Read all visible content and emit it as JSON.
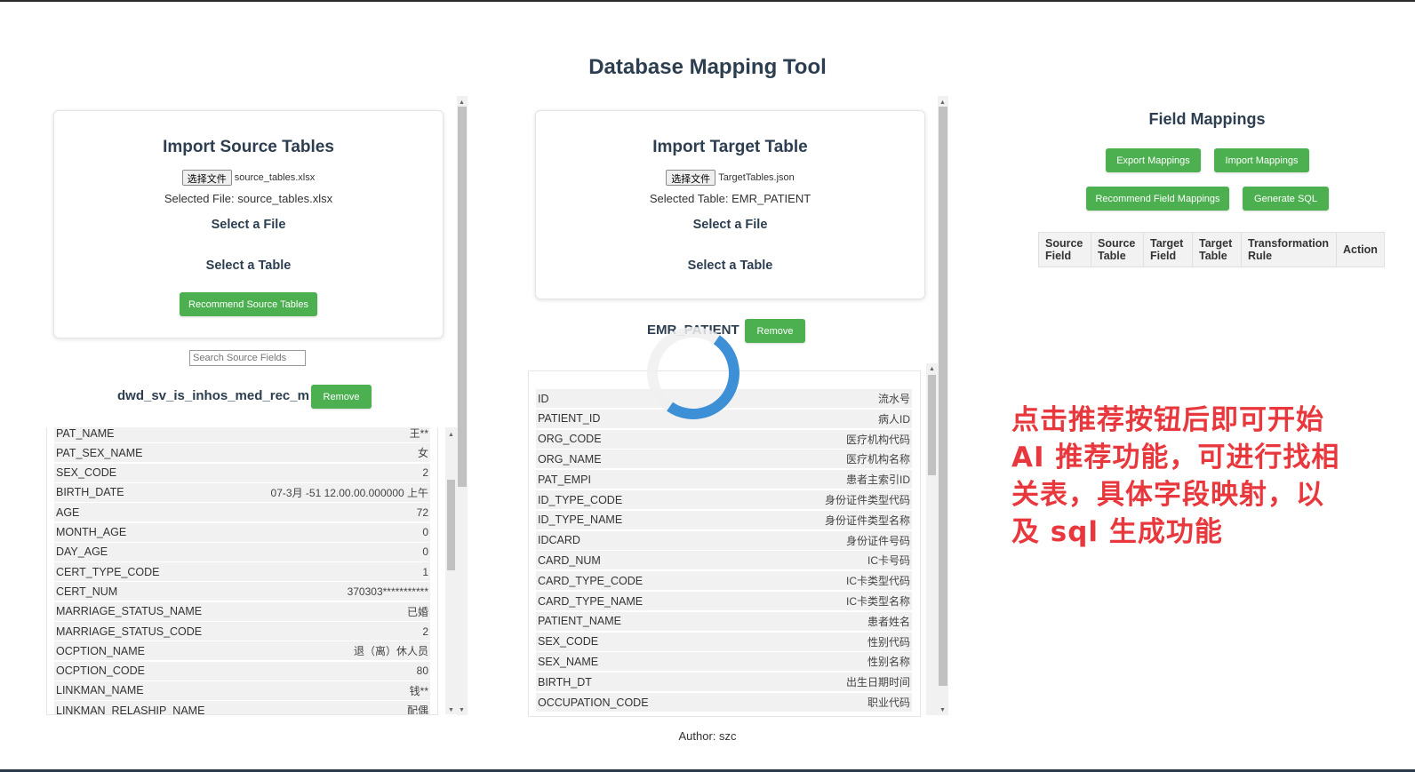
{
  "app": {
    "title": "Database Mapping Tool",
    "author": "Author: szc"
  },
  "source": {
    "heading": "Import Source Tables",
    "choose_file_label": "选择文件",
    "file_name": "source_tables.xlsx",
    "selected_file_text": "Selected File: source_tables.xlsx",
    "select_file_heading": "Select a File",
    "select_table_heading": "Select a Table",
    "recommend_button": "Recommend Source Tables",
    "search_placeholder": "Search Source Fields",
    "table_name": "dwd_sv_is_inhos_med_rec_m",
    "remove_button": "Remove",
    "fields": [
      {
        "name": "PAT_NAME",
        "value": "王**"
      },
      {
        "name": "PAT_SEX_NAME",
        "value": "女"
      },
      {
        "name": "SEX_CODE",
        "value": "2"
      },
      {
        "name": "BIRTH_DATE",
        "value": "07-3月 -51 12.00.00.000000 上午"
      },
      {
        "name": "AGE",
        "value": "72"
      },
      {
        "name": "MONTH_AGE",
        "value": "0"
      },
      {
        "name": "DAY_AGE",
        "value": "0"
      },
      {
        "name": "CERT_TYPE_CODE",
        "value": "1"
      },
      {
        "name": "CERT_NUM",
        "value": "370303***********"
      },
      {
        "name": "MARRIAGE_STATUS_NAME",
        "value": "已婚"
      },
      {
        "name": "MARRIAGE_STATUS_CODE",
        "value": "2"
      },
      {
        "name": "OCPTION_NAME",
        "value": "退（离）休人员"
      },
      {
        "name": "OCPTION_CODE",
        "value": "80"
      },
      {
        "name": "LINKMAN_NAME",
        "value": "钱**"
      },
      {
        "name": "LINKMAN_RELASHIP_NAME",
        "value": "配偶"
      }
    ]
  },
  "target": {
    "heading": "Import Target Table",
    "choose_file_label": "选择文件",
    "file_name": "TargetTables.json",
    "selected_table_text": "Selected Table: EMR_PATIENT",
    "select_file_heading": "Select a File",
    "select_table_heading": "Select a Table",
    "table_name": "EMR_PATIENT",
    "remove_button": "Remove",
    "fields": [
      {
        "name": "ID",
        "value": "流水号"
      },
      {
        "name": "PATIENT_ID",
        "value": "病人ID"
      },
      {
        "name": "ORG_CODE",
        "value": "医疗机构代码"
      },
      {
        "name": "ORG_NAME",
        "value": "医疗机构名称"
      },
      {
        "name": "PAT_EMPI",
        "value": "患者主索引ID"
      },
      {
        "name": "ID_TYPE_CODE",
        "value": "身份证件类型代码"
      },
      {
        "name": "ID_TYPE_NAME",
        "value": "身份证件类型名称"
      },
      {
        "name": "IDCARD",
        "value": "身份证件号码"
      },
      {
        "name": "CARD_NUM",
        "value": "IC卡号码"
      },
      {
        "name": "CARD_TYPE_CODE",
        "value": "IC卡类型代码"
      },
      {
        "name": "CARD_TYPE_NAME",
        "value": "IC卡类型名称"
      },
      {
        "name": "PATIENT_NAME",
        "value": "患者姓名"
      },
      {
        "name": "SEX_CODE",
        "value": "性别代码"
      },
      {
        "name": "SEX_NAME",
        "value": "性别名称"
      },
      {
        "name": "BIRTH_DT",
        "value": "出生日期时间"
      },
      {
        "name": "OCCUPATION_CODE",
        "value": "职业代码"
      }
    ]
  },
  "mappings": {
    "heading": "Field Mappings",
    "export_button": "Export Mappings",
    "import_button": "Import Mappings",
    "recommend_button": "Recommend Field Mappings",
    "generate_sql_button": "Generate SQL",
    "columns": [
      "Source Field",
      "Source Table",
      "Target Field",
      "Target Table",
      "Transformation Rule",
      "Action"
    ]
  },
  "annotation": {
    "text_lines": [
      "点击推荐按钮后即可开始",
      " AI 推荐功能，可进行找相",
      "关表，具体字段映射，以",
      "及 sql 生成功能"
    ],
    "color": "#e8383d"
  },
  "colors": {
    "accent_green": "#4caf50",
    "spinner_blue": "#3d8fd6",
    "heading": "#2c3e50"
  }
}
